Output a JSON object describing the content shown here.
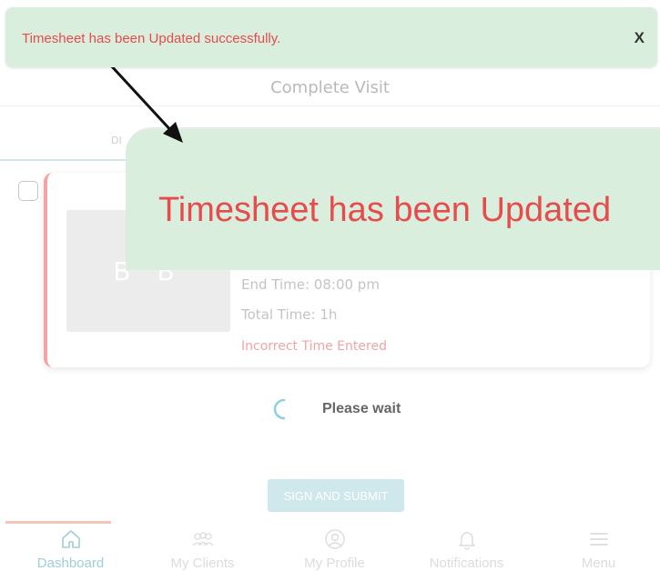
{
  "toast": {
    "message": "Timesheet has been Updated successfully.",
    "close_label": "X"
  },
  "zoom_callout": {
    "text": "Timesheet has been Updated"
  },
  "page": {
    "title": "Complete Visit",
    "tab_peek": "DI"
  },
  "visit_card": {
    "initials": "B B",
    "end_time": "End Time: 08:00 pm",
    "total_time": "Total Time: 1h",
    "warning": "Incorrect Time Entered"
  },
  "loading": {
    "text": "Please wait"
  },
  "submit_button": {
    "label": "SIGN AND SUBMIT"
  },
  "bottom_nav": {
    "items": [
      {
        "label": "Dashboard",
        "icon": "home-icon",
        "active": true
      },
      {
        "label": "My Clients",
        "icon": "clients-icon",
        "active": false
      },
      {
        "label": "My Profile",
        "icon": "profile-icon",
        "active": false
      },
      {
        "label": "Notifications",
        "icon": "bell-icon",
        "active": false
      },
      {
        "label": "Menu",
        "icon": "menu-icon",
        "active": false
      }
    ]
  },
  "colors": {
    "toast_bg": "#d9eedd",
    "toast_text": "#e74b4b",
    "accent_teal": "#9fcfd6",
    "warning_text": "#f4a3a3"
  }
}
